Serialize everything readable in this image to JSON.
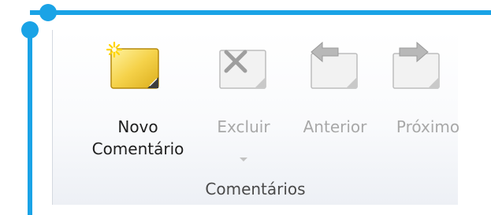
{
  "colors": {
    "accent": "#1aa3e6"
  },
  "ribbon": {
    "group_label": "Comentários",
    "buttons": {
      "new_comment": {
        "line1": "Novo",
        "line2": "Comentário",
        "icon": "new-comment-icon"
      },
      "delete": {
        "label": "Excluir",
        "icon": "delete-comment-icon"
      },
      "previous": {
        "label": "Anterior",
        "icon": "previous-comment-icon"
      },
      "next": {
        "label": "Próximo",
        "icon": "next-comment-icon"
      }
    }
  }
}
